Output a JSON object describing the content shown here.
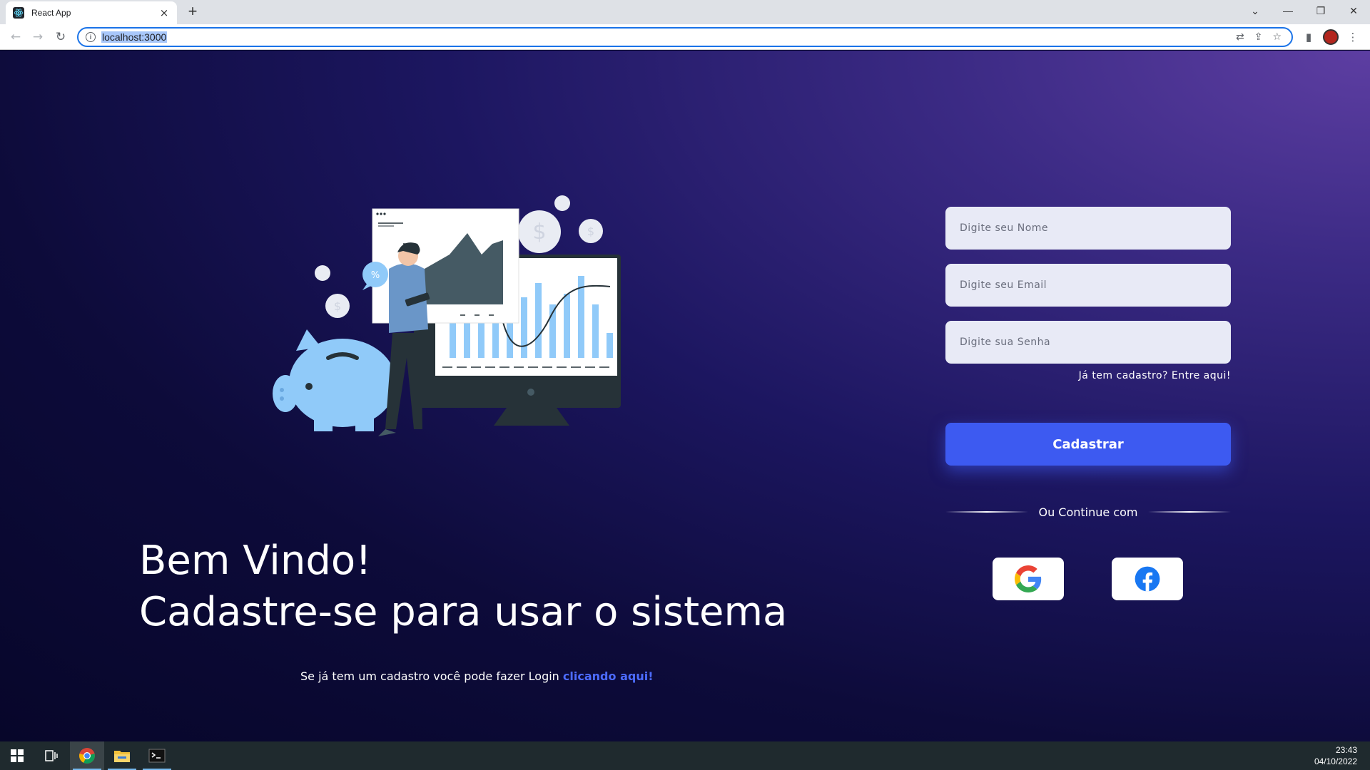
{
  "browser": {
    "tab_title": "React App",
    "tab_close": "×",
    "new_tab": "+",
    "url": "localhost:3000"
  },
  "page": {
    "heading_line1": "Bem Vindo!",
    "heading_line2": "Cadastre-se para usar o sistema",
    "login_prompt": "Se já tem um cadastro você pode fazer Login",
    "login_link": "clicando aqui!"
  },
  "form": {
    "name_placeholder": "Digite seu Nome",
    "email_placeholder": "Digite seu Email",
    "password_placeholder": "Digite sua Senha",
    "already_registered": "Já tem cadastro? Entre aqui!",
    "submit_label": "Cadastrar",
    "divider_label": "Ou Continue com"
  },
  "social": {
    "google_icon": "google-icon",
    "facebook_icon": "facebook-icon"
  },
  "taskbar": {
    "time": "23:43",
    "date": "04/10/2022"
  },
  "colors": {
    "accent": "#3d5af1",
    "link": "#4c6bff",
    "background_dark": "#07062a",
    "background_light": "#5d3ea2"
  }
}
